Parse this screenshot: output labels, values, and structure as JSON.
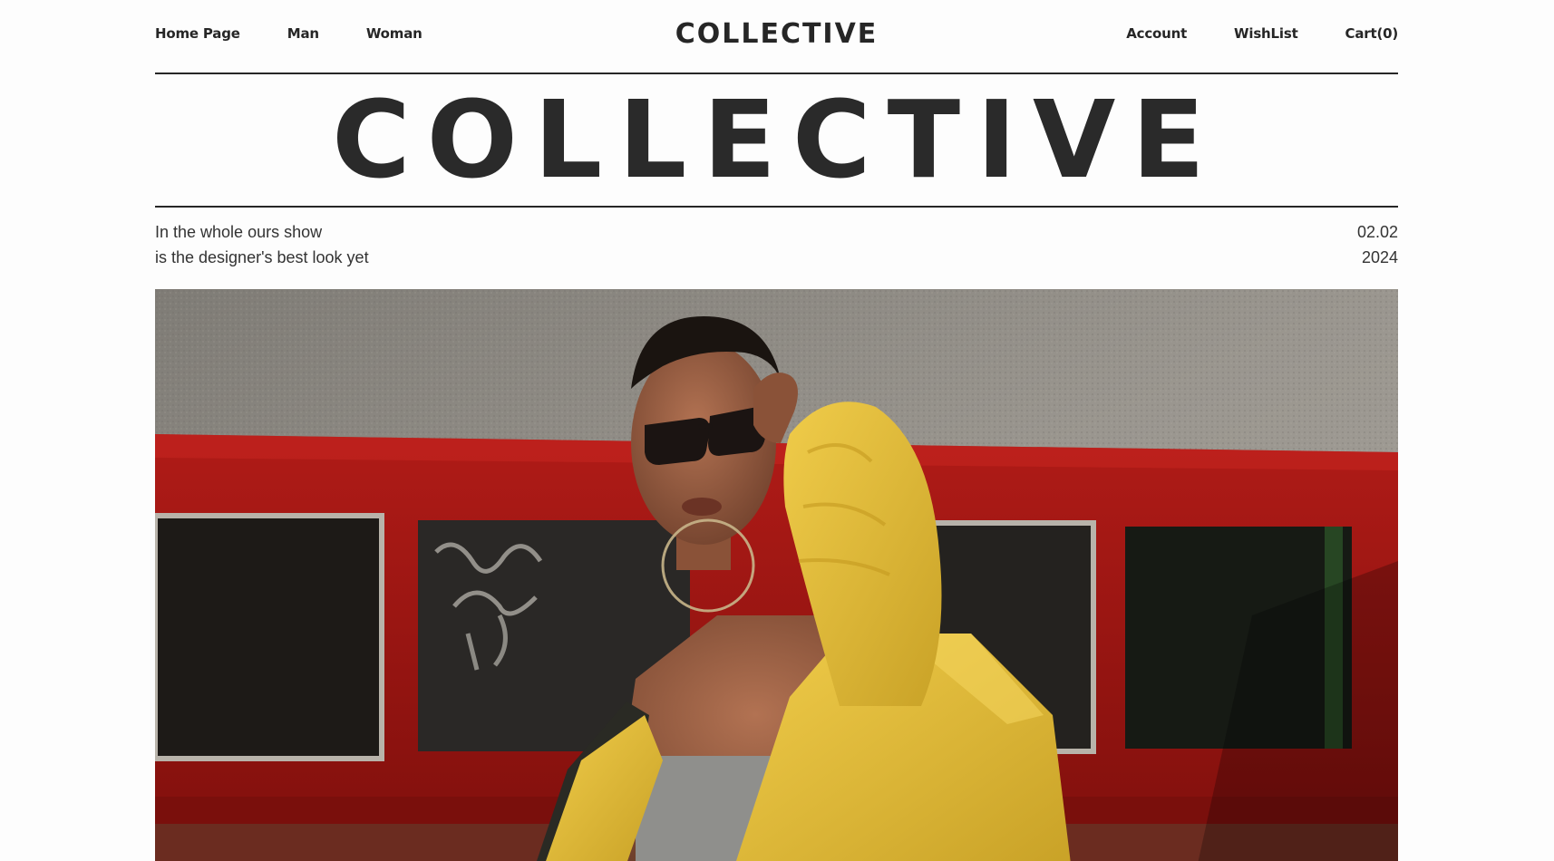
{
  "header": {
    "brand": "COLLECTIVE",
    "nav_left": [
      {
        "label": "Home Page"
      },
      {
        "label": "Man"
      },
      {
        "label": "Woman"
      }
    ],
    "nav_right": [
      {
        "label": "Account"
      },
      {
        "label": "WishList"
      },
      {
        "label": "Cart(0)"
      }
    ]
  },
  "hero": {
    "title": "COLLECTIVE",
    "tagline_line1": "In the whole ours show",
    "tagline_line2": "is the designer's best look yet",
    "date_line1": "02.02",
    "date_line2": "2024",
    "image_description_icon": "fashion-photo-icon"
  },
  "colors": {
    "text": "#262626",
    "background": "#fdfdfd",
    "accent_red": "#9e1414",
    "accent_yellow": "#e6c23a"
  }
}
